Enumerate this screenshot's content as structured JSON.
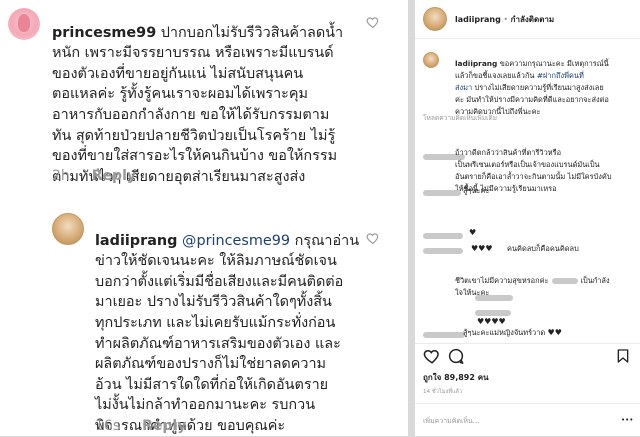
{
  "left_panel": {
    "comment1": {
      "username": "princesme99",
      "lines": [
        "ปากบอกไม่รับรีวิวสินค้าลดน้ำ",
        "หนัก เพราะมีจรรยาบรรณ หรือเพราะมีแบรนด์",
        "ของตัวเองที่ขายอยู่กันแน่ ไม่สนับสนุนคน",
        "ตอแหลค่ะ รู้ทั้งรู้คนเราจะผอมได้เพราะคุม",
        "อาหารกับออกกำลังกาย ขอให้ได้รับกรรมตาม",
        "ทัน สุดท้ายป่วยปลายชีวิตป่วยเป็นโรคร้าย ไม่รู้",
        "ของที่ขายใส่สารอะไรให้คนกินบ้าง ขอให้กรรม",
        "ตามทันไวๆ เสียดายอุตส่าเรียนมาสะสูงส่ง"
      ],
      "time": "2h",
      "reply_label": "Reply"
    },
    "comment2": {
      "username": "ladiiprang",
      "mention": "@princesme99",
      "first_line_rest": "กรุณาอ่าน",
      "lines": [
        "ข่าวให้ชัดเจนนะคะ ให้ลิมภาษณ์ชัดเจน",
        "บอกว่าตั้งแต่เริ่มมีชื่อเสียงและมีคนติดต่อ",
        "มาเยอะ ปรางไม่รับรีวิวสินค้าใดๆทั้งสิ้น",
        "ทุกประเภท และไม่เคยรับแม้กระทั่งก่อน",
        "ทำผลิตภัณฑ์อาหารเสริมของตัวเอง และ",
        "ผลิตภัณฑ์ของปรางก็ไม่ใช่ยาลดความ",
        "อ้วน ไม่มีสารใดใดที่ก่อให้เกิดอันตราย",
        "ไม่งั้นไม่กล้าทำออกมานะคะ รบกวน",
        "พิจารณาคำพูดด้วย ขอบคุณค่ะ"
      ],
      "time": "16s",
      "reply_label": "Reply"
    }
  },
  "right_panel": {
    "header": {
      "username": "ladiiprang",
      "separator": " • ",
      "follow_status": "กำลังติดตาม"
    },
    "caption": {
      "username": "ladiiprang",
      "line1_rest": " ขอความกรุณานะคะ มีเหตุการณ์นี้",
      "line2_before": "แล้วก็ขอชี้แจงเลยแล้วกัน ",
      "line2_hashtag": "#ฝากถึงพี่คนที่",
      "line3_hashtag": "ส่งมา",
      "line3_rest": " ปรางไม่เสียดายความรู้ที่เรียนมาสูงส่งเลย",
      "line4": "ค่ะ มันทำให้ปรางมีความคิดที่ดีและอยากจะส่งต่อ",
      "line5": "ความคิดบวกนี้ไปถึงพี่นะคะ"
    },
    "load_more": "โหลดความคิดเห็นเพิ่มเติม",
    "comment_a": [
      "ถ้าวาดีตกล้วว่าสินค้าที่ตารีวิวหรือ",
      "เป็นพรีเซนเตอร์หรือเป็นเจ้าของแบรนด์มันเป็น",
      "อันตรายก็คือเอาล้ำวาจะกินตามนั้ม ไม่มีใครบังคับ",
      "ให้ซื้อนี้ ไม่มีความรู้เรียนมาเหรอ"
    ],
    "comment_b": "สู้ๆนะคะ",
    "comment_c_hearts": "♥",
    "comment_d_hearts": "♥♥♥",
    "comment_d_text": "คนคิดลบก็คือคนคิดลบ",
    "comment_e": [
      "ชีวิตเขาไม่มีความสุขหรอกค่ะ",
      "เป็นกำลัง",
      "ใจให้นะคะ"
    ],
    "comment_f": "♥♥♥♥",
    "comment_g": "สู้ๆนะคะแม่หญิงจันทร์วาด",
    "comment_g_hearts": "♥♥",
    "likes": "ถูกใจ 89,892 คน",
    "time_ago": "14 ชั่วโมงที่แล้ว",
    "add_comment_placeholder": "เพิ่มความคิดเห็น...",
    "more_options": "•••"
  }
}
